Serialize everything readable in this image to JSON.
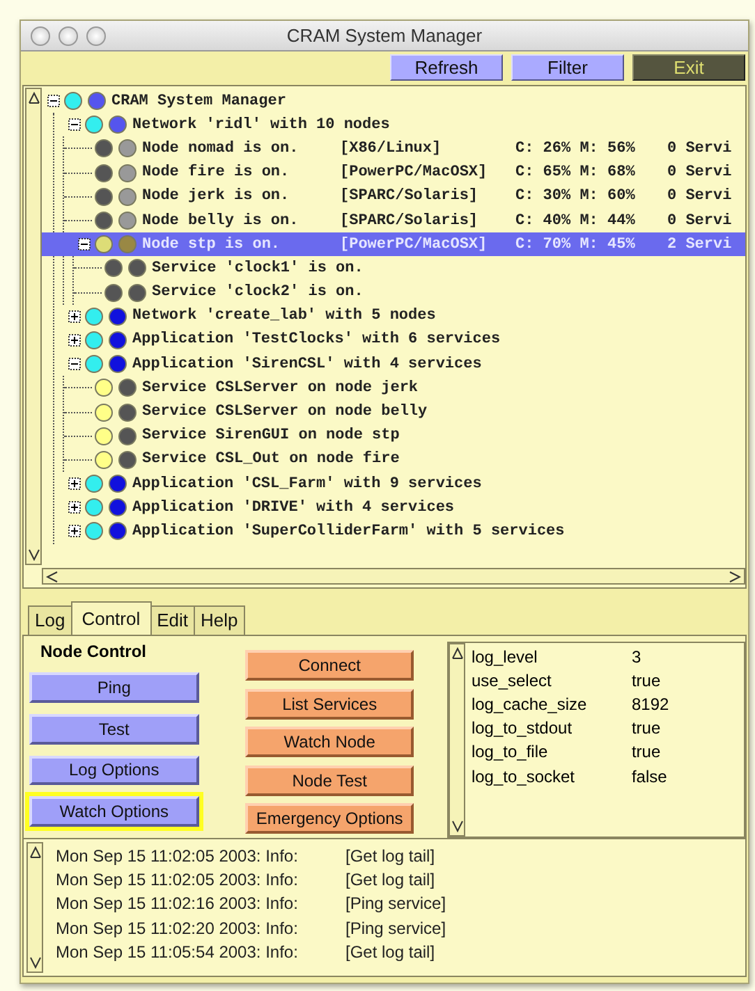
{
  "window": {
    "title": "CRAM System Manager"
  },
  "toolbar": [
    {
      "label": "Refresh",
      "kind": "normal"
    },
    {
      "label": "Filter",
      "kind": "normal"
    },
    {
      "label": "Exit",
      "kind": "exit"
    }
  ],
  "tree": [
    {
      "label": "CRAM System Manager",
      "expanded": true,
      "selected": false,
      "lights": [
        {
          "color": "#33eeee"
        },
        {
          "color": "#5555ee"
        }
      ],
      "children": [
        {
          "label": "Network 'ridl' with 10 nodes",
          "expanded": true,
          "selected": false,
          "lights": [
            {
              "color": "#33eeee"
            },
            {
              "color": "#5555ee"
            }
          ],
          "children": [
            {
              "label": "Node nomad is on.",
              "platform": "[X86/Linux]",
              "load": "C: 26% M: 56%",
              "services": "0 Servi",
              "selected": false,
              "lights": [
                {
                  "color": "#555555"
                },
                {
                  "color": "#999999"
                }
              ]
            },
            {
              "label": "Node fire is on.",
              "platform": "[PowerPC/MacOSX]",
              "load": "C: 65% M: 68%",
              "services": "0 Servi",
              "selected": false,
              "lights": [
                {
                  "color": "#555555"
                },
                {
                  "color": "#999999"
                }
              ]
            },
            {
              "label": "Node jerk is on.",
              "platform": "[SPARC/Solaris]",
              "load": "C: 30% M: 60%",
              "services": "0 Servi",
              "selected": false,
              "lights": [
                {
                  "color": "#555555"
                },
                {
                  "color": "#999999"
                }
              ]
            },
            {
              "label": "Node belly is on.",
              "platform": "[SPARC/Solaris]",
              "load": "C: 40% M: 44%",
              "services": "0 Servi",
              "selected": false,
              "lights": [
                {
                  "color": "#555555"
                },
                {
                  "color": "#999999"
                }
              ]
            },
            {
              "label": "Node stp is on.",
              "platform": "[PowerPC/MacOSX]",
              "load": "C: 70% M: 45%",
              "services": "2 Servi",
              "expanded": true,
              "selected": true,
              "lights": [
                {
                  "color": "#dddd77"
                },
                {
                  "color": "#998844"
                }
              ],
              "children": [
                {
                  "label": "Service 'clock1' is on.",
                  "selected": false,
                  "lights": [
                    {
                      "color": "#555555"
                    },
                    {
                      "color": "#555555"
                    }
                  ]
                },
                {
                  "label": "Service 'clock2' is on.",
                  "selected": false,
                  "lights": [
                    {
                      "color": "#555555"
                    },
                    {
                      "color": "#555555"
                    }
                  ]
                }
              ]
            }
          ]
        },
        {
          "label": "Network 'create_lab' with 5 nodes",
          "expanded": false,
          "selected": false,
          "lights": [
            {
              "color": "#33eeee"
            },
            {
              "color": "#1111dd"
            }
          ]
        },
        {
          "label": "Application 'TestClocks' with 6 services",
          "expanded": false,
          "selected": false,
          "lights": [
            {
              "color": "#33eeee"
            },
            {
              "color": "#1111dd"
            }
          ]
        },
        {
          "label": "Application 'SirenCSL' with 4 services",
          "expanded": true,
          "selected": false,
          "lights": [
            {
              "color": "#33eeee"
            },
            {
              "color": "#1111dd"
            }
          ],
          "children": [
            {
              "label": "Service CSLServer on node jerk",
              "selected": false,
              "lights": [
                {
                  "color": "#ffff88"
                },
                {
                  "color": "#555555"
                }
              ]
            },
            {
              "label": "Service CSLServer on node belly",
              "selected": false,
              "lights": [
                {
                  "color": "#ffff88"
                },
                {
                  "color": "#555555"
                }
              ]
            },
            {
              "label": "Service SirenGUI on node stp",
              "selected": false,
              "lights": [
                {
                  "color": "#ffff88"
                },
                {
                  "color": "#555555"
                }
              ]
            },
            {
              "label": "Service CSL_Out on node fire",
              "selected": false,
              "lights": [
                {
                  "color": "#ffff88"
                },
                {
                  "color": "#555555"
                }
              ]
            }
          ]
        },
        {
          "label": "Application 'CSL_Farm' with 9 services",
          "expanded": false,
          "selected": false,
          "lights": [
            {
              "color": "#33eeee"
            },
            {
              "color": "#1111dd"
            }
          ]
        },
        {
          "label": "Application 'DRIVE' with 4 services",
          "expanded": false,
          "selected": false,
          "lights": [
            {
              "color": "#33eeee"
            },
            {
              "color": "#1111dd"
            }
          ]
        },
        {
          "label": "Application 'SuperColliderFarm' with 5 services",
          "expanded": false,
          "selected": false,
          "lights": [
            {
              "color": "#33eeee"
            },
            {
              "color": "#1111dd"
            }
          ]
        }
      ]
    }
  ],
  "tabs": [
    {
      "label": "Log",
      "selected": false
    },
    {
      "label": "Control",
      "selected": true
    },
    {
      "label": "Edit",
      "selected": false
    },
    {
      "label": "Help",
      "selected": false
    }
  ],
  "control": {
    "heading": "Node Control",
    "left_buttons": [
      {
        "label": "Ping",
        "focused": false
      },
      {
        "label": "Test",
        "focused": false
      },
      {
        "label": "Log Options",
        "focused": false
      },
      {
        "label": "Watch Options",
        "focused": true
      }
    ],
    "right_buttons": [
      {
        "label": "Connect"
      },
      {
        "label": "List Services"
      },
      {
        "label": "Watch Node"
      },
      {
        "label": "Node Test"
      },
      {
        "label": "Emergency Options"
      }
    ]
  },
  "properties": [
    {
      "name": "log_level",
      "value": "3"
    },
    {
      "name": "use_select",
      "value": "true"
    },
    {
      "name": "log_cache_size",
      "value": "8192"
    },
    {
      "name": "log_to_stdout",
      "value": "true"
    },
    {
      "name": "log_to_file",
      "value": "true"
    },
    {
      "name": "log_to_socket",
      "value": "false"
    }
  ],
  "log": [
    {
      "time": "Mon Sep 15 11:02:05 2003: Info:",
      "message": "[Get log tail]"
    },
    {
      "time": "Mon Sep 15 11:02:05 2003: Info:",
      "message": "[Get log tail]"
    },
    {
      "time": "Mon Sep 15 11:02:16 2003: Info:",
      "message": "[Ping service]"
    },
    {
      "time": "Mon Sep 15 11:02:20 2003: Info:",
      "message": "[Ping service]"
    },
    {
      "time": "Mon Sep 15 11:05:54 2003: Info:",
      "message": "[Get log tail]"
    }
  ]
}
